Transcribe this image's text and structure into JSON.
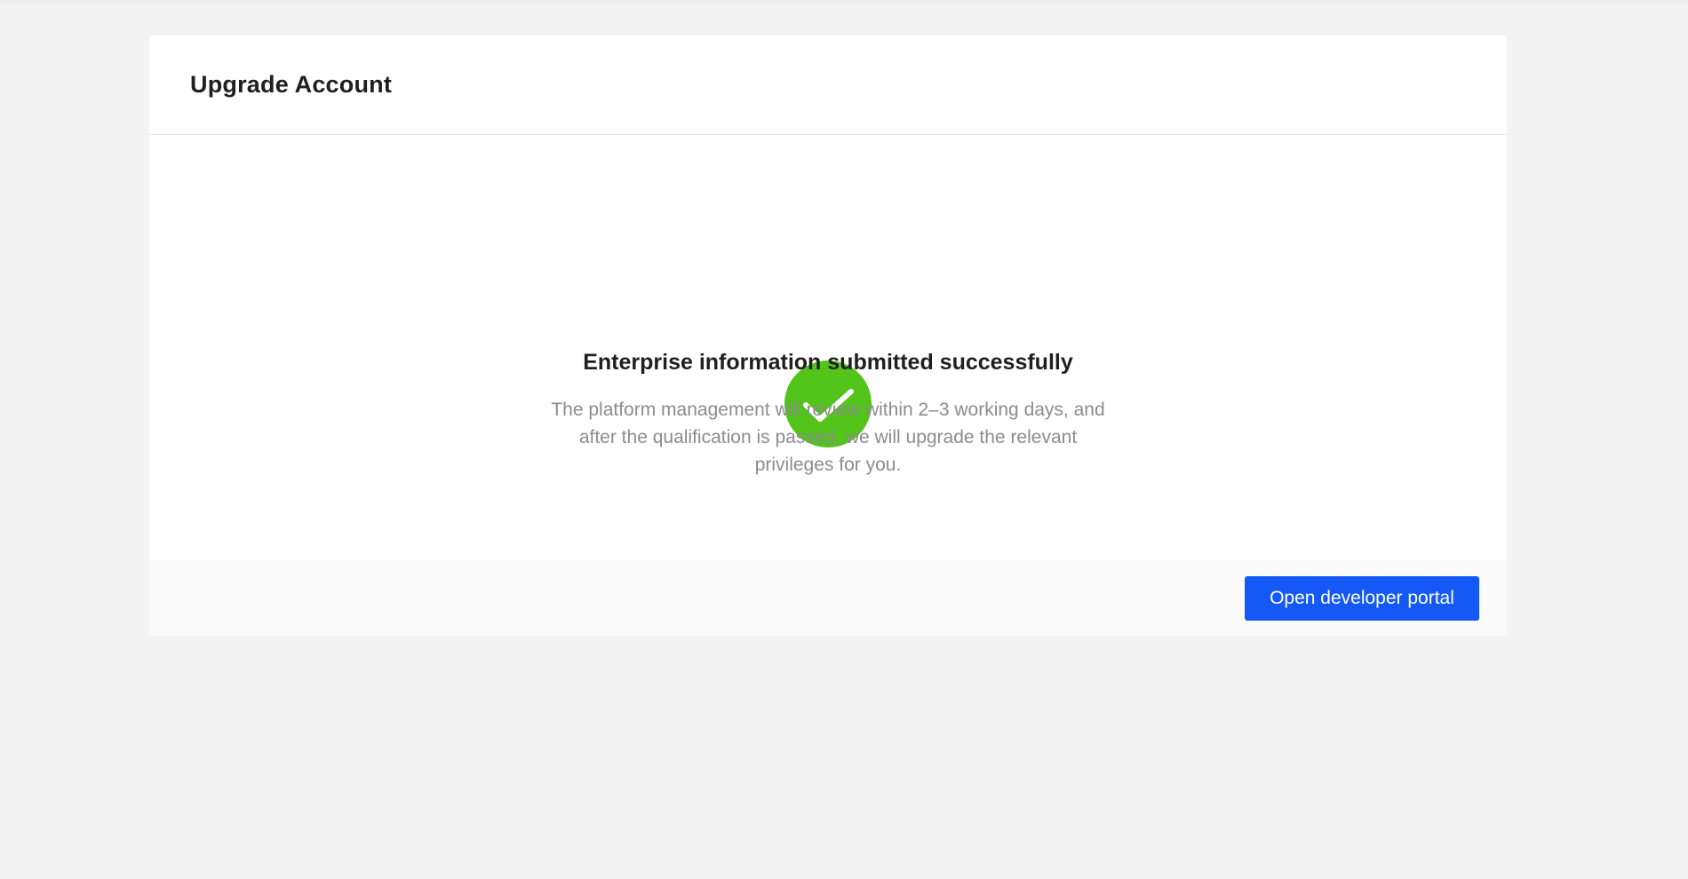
{
  "header": {
    "title": "Upgrade Account"
  },
  "result": {
    "status": "success",
    "icon": "check-circle-icon",
    "icon_color": "#52c41a",
    "title": "Enterprise information submitted successfully",
    "description": "The platform management will review within 2–3 working days, and after the qualification is passed, we will upgrade the relevant privileges for you."
  },
  "footer": {
    "button_label": "Open developer portal",
    "button_color": "#1459f5"
  }
}
